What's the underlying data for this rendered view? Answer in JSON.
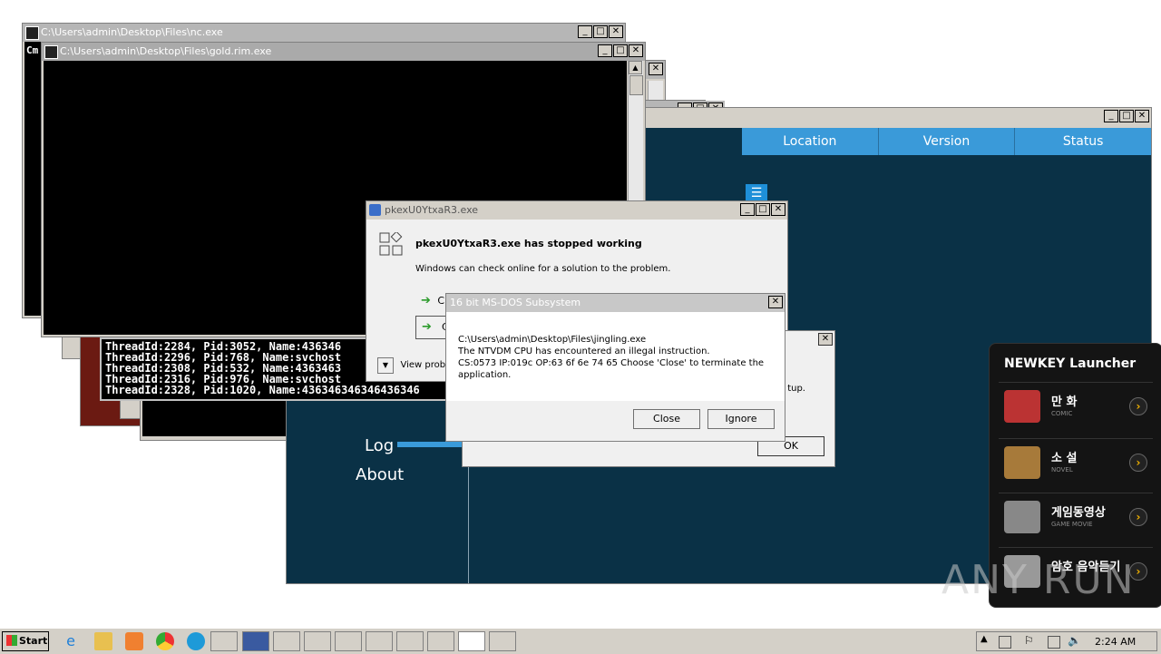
{
  "windows": {
    "nc": {
      "title": "C:\\Users\\admin\\Desktop\\Files\\nc.exe",
      "side_text": "Cm"
    },
    "gold": {
      "title": "C:\\Users\\admin\\Desktop\\Files\\gold.rim.exe"
    },
    "console_lines": [
      "ThreadId:2284, Pid:3052, Name:436346",
      "ThreadId:2296, Pid:768, Name:svchost",
      "ThreadId:2308, Pid:532, Name:4363463",
      "ThreadId:2316, Pid:976, Name:svchost",
      "ThreadId:2328, Pid:1020, Name:436346346346436346"
    ]
  },
  "app": {
    "columns": [
      "Location",
      "Version",
      "Status"
    ],
    "menu": [
      "Log",
      "About"
    ]
  },
  "crash_dialog": {
    "title": "pkexU0YtxaR3.exe",
    "heading": "pkexU0YtxaR3.exe has stopped working",
    "body": "Windows can check online for a solution to the problem.",
    "option1": "C",
    "option2": "C",
    "details": "View probl"
  },
  "msdos_dialog": {
    "title": "16 bit MS-DOS Subsystem",
    "path": "C:\\Users\\admin\\Desktop\\Files\\jingling.exe",
    "line1": "The NTVDM CPU has encountered an illegal instruction.",
    "line2": "CS:0573 IP:019c OP:63 6f 6e 74 65 Choose 'Close' to terminate the",
    "line3": "application.",
    "close_label": "Close",
    "ignore_label": "Ignore"
  },
  "back_dialog": {
    "text_fragment": "tup.",
    "ok_label": "OK"
  },
  "newkey": {
    "title": "NEWKEY Launcher",
    "items": [
      {
        "label": "만 화",
        "sub": "COMIC"
      },
      {
        "label": "소 설",
        "sub": "NOVEL"
      },
      {
        "label": "게임동영상",
        "sub": "GAME MOVIE"
      },
      {
        "label": "암호 음악듣기",
        "sub": ""
      }
    ]
  },
  "taskbar": {
    "start_label": "Start",
    "clock": "2:24 AM"
  },
  "watermark": "ANY RUN",
  "colors": {
    "app_header": "#3a9ad9",
    "app_bg": "#0a3146",
    "newkey_bg": "#141414"
  }
}
